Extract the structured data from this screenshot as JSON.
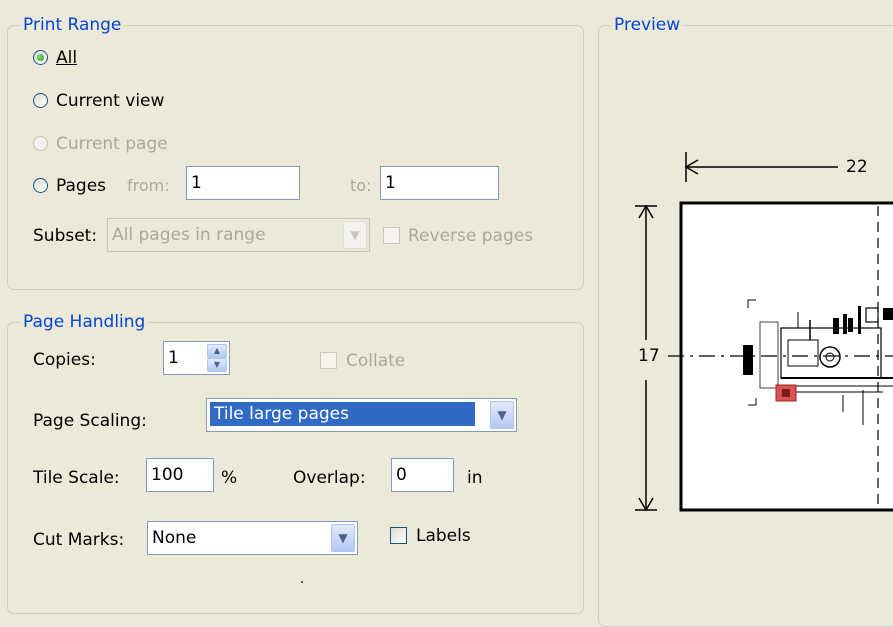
{
  "print_range": {
    "legend": "Print Range",
    "all": "All",
    "current_view": "Current view",
    "current_page": "Current page",
    "pages": "Pages",
    "from_label": "from:",
    "from_value": "1",
    "to_label": "to:",
    "to_value": "1",
    "subset_label": "Subset:",
    "subset_value": "All pages in range",
    "reverse_pages": "Reverse pages",
    "selected": "All"
  },
  "page_handling": {
    "legend": "Page Handling",
    "copies_label": "Copies:",
    "copies_value": "1",
    "collate": "Collate",
    "page_scaling_label": "Page Scaling:",
    "page_scaling_value": "Tile large pages",
    "tile_scale_label": "Tile Scale:",
    "tile_scale_value": "100",
    "tile_scale_unit": "%",
    "overlap_label": "Overlap:",
    "overlap_value": "0",
    "overlap_unit": "in",
    "cut_marks_label": "Cut Marks:",
    "cut_marks_value": "None",
    "labels": "Labels",
    "labels_checked": false
  },
  "preview": {
    "legend": "Preview",
    "width_dimension": "22",
    "height_dimension": "17"
  },
  "colors": {
    "dialog_bg": "#ece9d8",
    "legend_text": "#0046d5",
    "selection_bg": "#316ac5",
    "disabled_text": "#aca899"
  },
  "icons": {
    "dropdown": "chevron-down-icon",
    "spin_up": "chevron-up-icon",
    "spin_down": "chevron-down-icon"
  }
}
